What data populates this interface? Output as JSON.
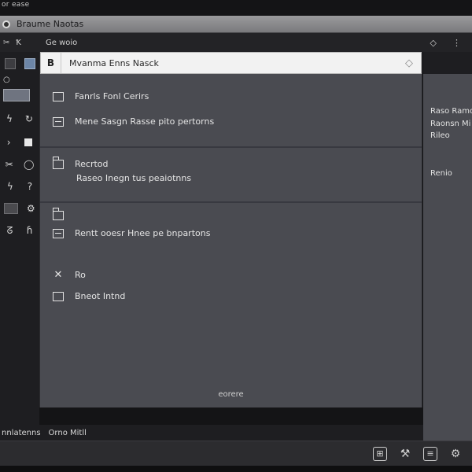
{
  "caption": "or ease",
  "window": {
    "title": "Braume Naotas"
  },
  "toolbar": {
    "label": "Ge woio",
    "left_icons": [
      "scissors-icon",
      "text-icon"
    ],
    "right_icons": [
      "diamond-icon",
      "menu-icon"
    ]
  },
  "search": {
    "value": "Mvanma Enns Nasck",
    "left_label": "B"
  },
  "items": {
    "i1": "Fanrls Fonl Cerirs",
    "i2": "Mene Sasgn Rasse pito pertorns",
    "i3": "Recrtod",
    "i4": "Raseo Inegn tus peaiotnns",
    "i5": "Rentt ooesr Hnee pe bnpartons",
    "i6": "Ro",
    "i7": "Bneot Intnd"
  },
  "main_footer": "eorere",
  "right_panel": {
    "lines": [
      "Raso Ramo",
      "Raonsn Mi",
      "Rileo",
      "Renio"
    ]
  },
  "status": {
    "left": "nnlatenns",
    "right": "Orno Mitll"
  }
}
